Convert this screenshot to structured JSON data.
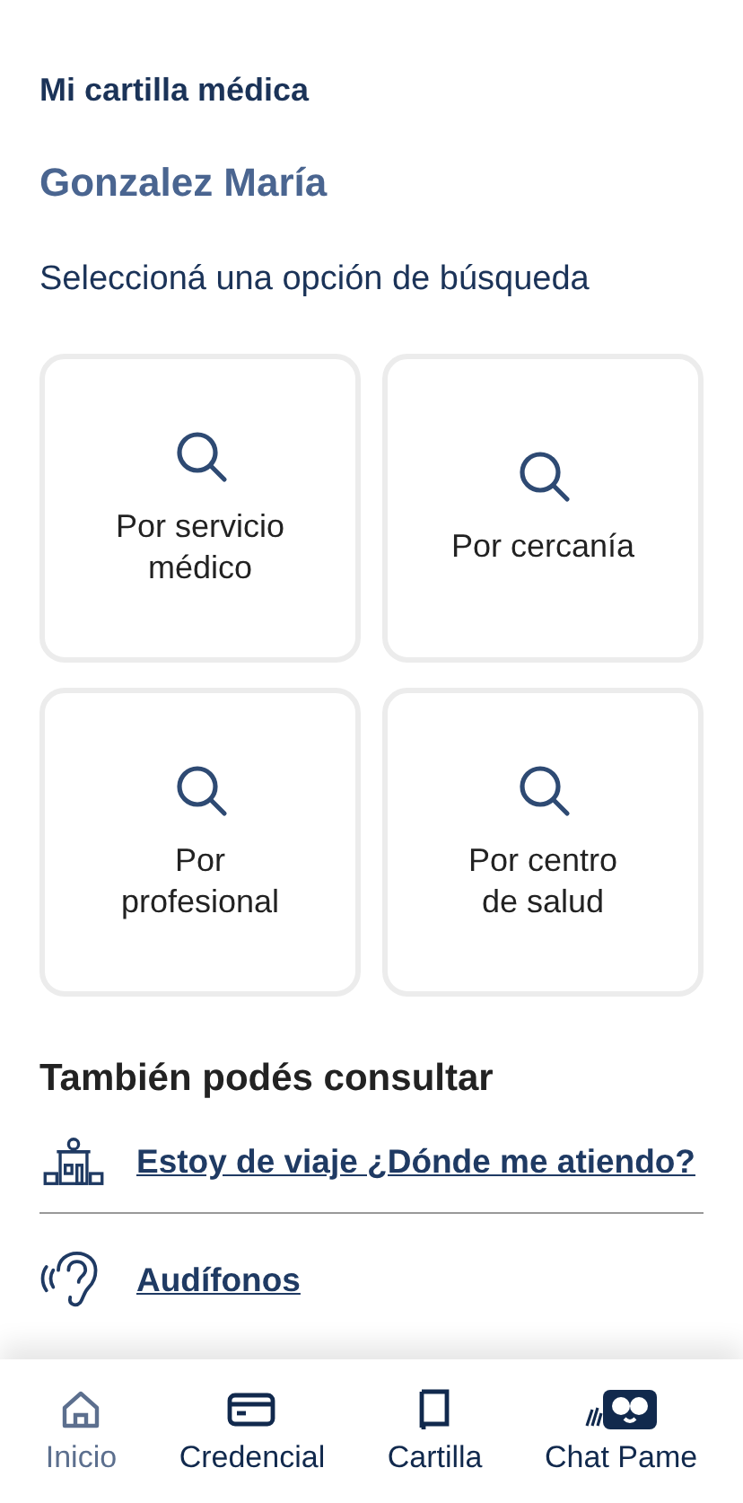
{
  "header": {
    "title": "Mi cartilla médica"
  },
  "user_name": "Gonzalez María",
  "prompt": "Seleccioná una opción de búsqueda",
  "search_options": [
    {
      "label": "Por servicio\nmédico"
    },
    {
      "label": "Por cercanía"
    },
    {
      "label": "Por\nprofesional"
    },
    {
      "label": "Por centro\nde salud"
    }
  ],
  "also_heading": "También podés consultar",
  "links": [
    {
      "kind": "travel",
      "label": "Estoy de viaje ¿Dónde me atiendo?"
    },
    {
      "kind": "hearing",
      "label": "Audífonos"
    }
  ],
  "bottom_nav": [
    {
      "kind": "home",
      "label": "Inicio",
      "selected": true
    },
    {
      "kind": "card",
      "label": "Credencial",
      "selected": false
    },
    {
      "kind": "book",
      "label": "Cartilla",
      "selected": false
    },
    {
      "kind": "chat",
      "label": "Chat Pame",
      "selected": false
    }
  ]
}
